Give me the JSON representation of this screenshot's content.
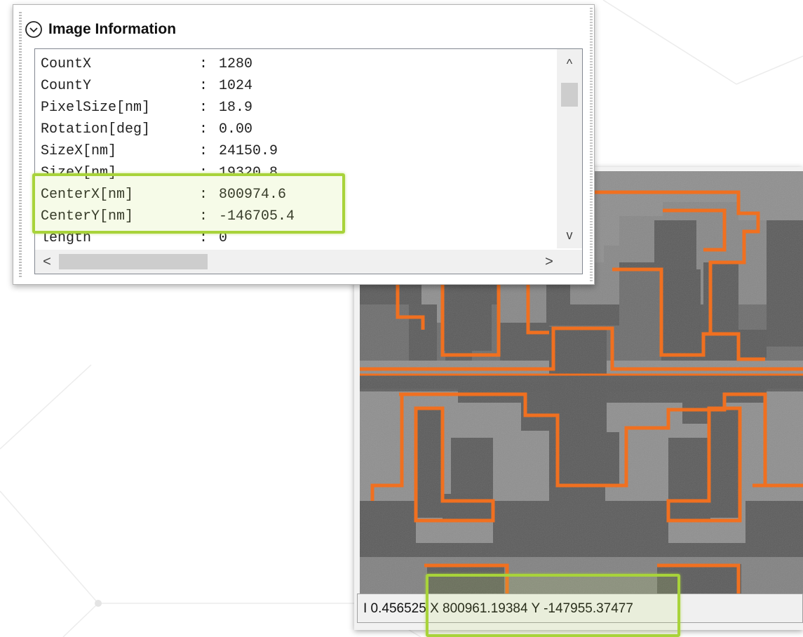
{
  "panel": {
    "title": "Image Information",
    "rows": [
      {
        "key": "CountX",
        "sep": ":",
        "value": "1280"
      },
      {
        "key": "CountY",
        "sep": ":",
        "value": "1024"
      },
      {
        "key": "PixelSize[nm]",
        "sep": ":",
        "value": "18.9"
      },
      {
        "key": "Rotation[deg]",
        "sep": ":",
        "value": "0.00"
      },
      {
        "key": "SizeX[nm]",
        "sep": ":",
        "value": "24150.9"
      },
      {
        "key": "SizeY[nm]",
        "sep": ":",
        "value": "19320.8"
      },
      {
        "key": "CenterX[nm]",
        "sep": ":",
        "value": "800974.6"
      },
      {
        "key": "CenterY[nm]",
        "sep": ":",
        "value": "-146705.4"
      },
      {
        "key": "length",
        "sep": ":",
        "value": "0"
      }
    ],
    "scroll_arrows": {
      "up": "^",
      "down": "v",
      "left": "<",
      "right": ">"
    }
  },
  "status_bar": {
    "text": "I 0.456525 X 800961.19384 Y -147955.37477"
  },
  "icons": {
    "collapse": "chevron-down-circle-icon"
  },
  "colors": {
    "highlight": "#a8d33a",
    "contour": "#f07020",
    "sem_dark": "#5a5a5a",
    "sem_light": "#8e8e8e"
  }
}
